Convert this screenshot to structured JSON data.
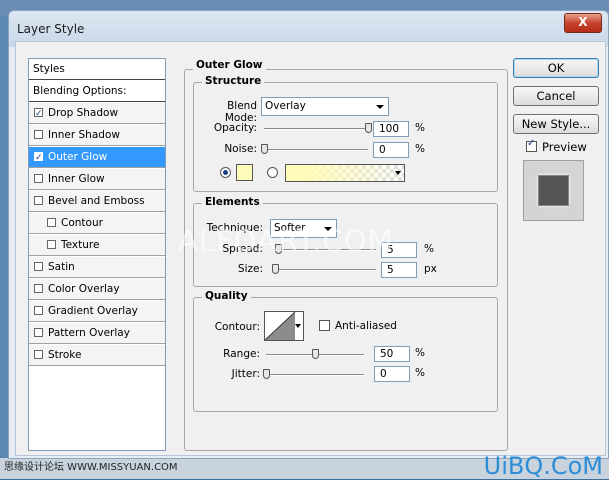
{
  "window": {
    "title": "Layer Style",
    "close_label": "X"
  },
  "styles_list": {
    "header": "Styles",
    "blending": "Blending Options: Default",
    "items": [
      {
        "label": "Drop Shadow",
        "checked": true
      },
      {
        "label": "Inner Shadow",
        "checked": false
      },
      {
        "label": "Outer Glow",
        "checked": true,
        "selected": true
      },
      {
        "label": "Inner Glow",
        "checked": false
      },
      {
        "label": "Bevel and Emboss",
        "checked": false
      },
      {
        "label": "Contour",
        "checked": false,
        "indent": true
      },
      {
        "label": "Texture",
        "checked": false,
        "indent": true
      },
      {
        "label": "Satin",
        "checked": false
      },
      {
        "label": "Color Overlay",
        "checked": false
      },
      {
        "label": "Gradient Overlay",
        "checked": false
      },
      {
        "label": "Pattern Overlay",
        "checked": false
      },
      {
        "label": "Stroke",
        "checked": false
      }
    ]
  },
  "outer_glow": {
    "title": "Outer Glow",
    "structure": {
      "title": "Structure",
      "blend_mode_label": "Blend Mode:",
      "blend_mode": "Overlay",
      "opacity_label": "Opacity:",
      "opacity": "100",
      "opacity_unit": "%",
      "noise_label": "Noise:",
      "noise": "0",
      "noise_unit": "%",
      "color_swatch": "#fffbb8"
    },
    "elements": {
      "title": "Elements",
      "technique_label": "Technique:",
      "technique": "Softer",
      "spread_label": "Spread:",
      "spread": "5",
      "spread_unit": "%",
      "size_label": "Size:",
      "size": "5",
      "size_unit": "px"
    },
    "quality": {
      "title": "Quality",
      "contour_label": "Contour:",
      "anti_aliased_label": "Anti-aliased",
      "range_label": "Range:",
      "range": "50",
      "range_unit": "%",
      "jitter_label": "Jitter:",
      "jitter": "0",
      "jitter_unit": "%"
    }
  },
  "buttons": {
    "ok": "OK",
    "cancel": "Cancel",
    "new_style": "New Style...",
    "preview": "Preview"
  },
  "watermarks": {
    "center": "ALFOART.COM",
    "bottom_left": "思缘设计论坛 WWW.MISSYUAN.COM",
    "bottom_right": "UiBQ.CoM"
  },
  "colors": {
    "selection": "#3399ff",
    "swatch": "#fffbb8",
    "preview_fill": "#555555"
  }
}
